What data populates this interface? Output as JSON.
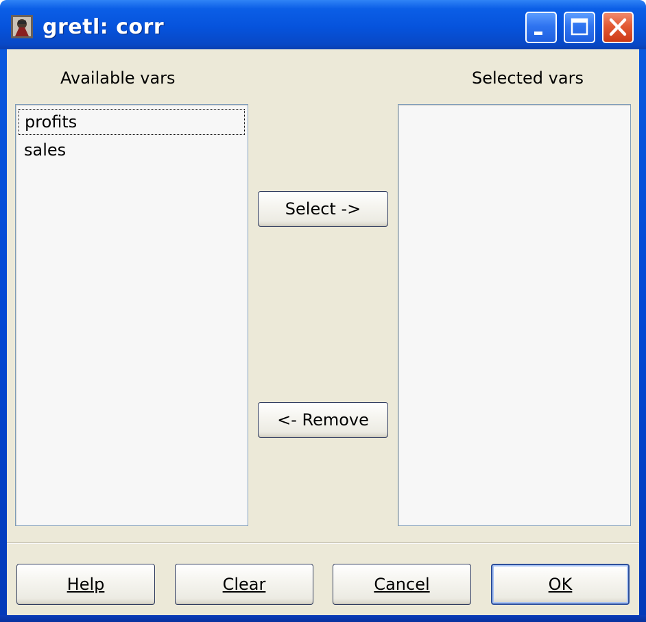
{
  "window": {
    "title": "gretl: corr",
    "controls": {
      "minimize_icon": "minimize-icon",
      "maximize_icon": "maximize-icon",
      "close_icon": "close-icon"
    }
  },
  "available": {
    "label": "Available vars",
    "items": [
      "profits",
      "sales"
    ],
    "focused_index": 0
  },
  "selected": {
    "label": "Selected vars",
    "items": []
  },
  "transfer": {
    "select_label": "Select ->",
    "remove_label": "<- Remove"
  },
  "footer": {
    "help_label": "Help",
    "clear_label": "Clear",
    "cancel_label": "Cancel",
    "ok_label": "OK"
  },
  "colors": {
    "titlebar": "#0653dc",
    "dialog_bg": "#ece9d8",
    "list_bg": "#f7f7f7",
    "close_button": "#e35a34"
  }
}
